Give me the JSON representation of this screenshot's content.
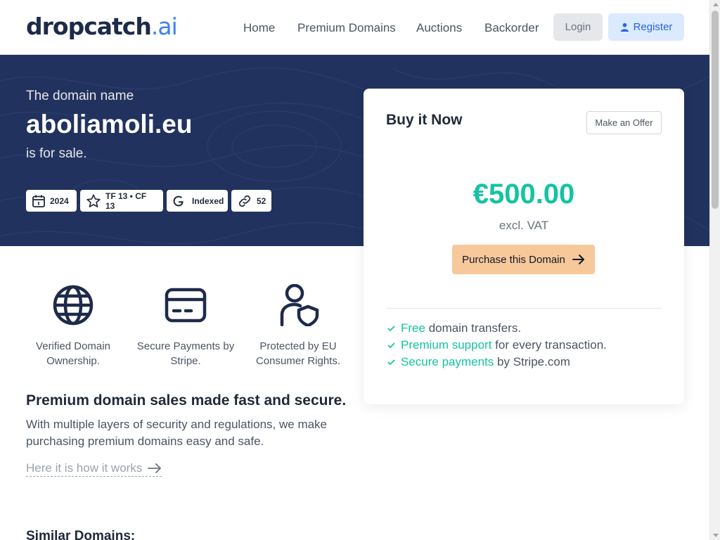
{
  "header": {
    "logo_main": "dropcatch",
    "logo_dot": ".",
    "logo_ai": "ai",
    "nav": [
      "Home",
      "Premium Domains",
      "Auctions",
      "Backorder"
    ],
    "login_label": "Login",
    "register_label": "Register"
  },
  "hero": {
    "intro": "The domain name",
    "domain": "aboliamoli.eu",
    "for_sale": "is for sale.",
    "badges": {
      "year": "2024",
      "trust": "TF 13 • CF 13",
      "google": "Indexed",
      "links": "52"
    }
  },
  "card": {
    "title": "Buy it Now",
    "offer_label": "Make an Offer",
    "price": "€500.00",
    "vat": "excl. VAT",
    "buy_label": "Purchase this Domain",
    "features": [
      {
        "highlight": "Free",
        "rest": "domain transfers."
      },
      {
        "highlight": "Premium support",
        "rest": "for every transaction."
      },
      {
        "highlight": "Secure payments",
        "rest": "by Stripe.com"
      }
    ]
  },
  "trust": [
    {
      "icon": "globe-icon",
      "line1": "Verified Domain",
      "line2": "Ownership."
    },
    {
      "icon": "credit-card-icon",
      "line1": "Secure Payments by",
      "line2": "Stripe."
    },
    {
      "icon": "user-shield-icon",
      "line1": "Protected by EU",
      "line2": "Consumer Rights."
    }
  ],
  "info": {
    "title": "Premium domain sales made fast and secure.",
    "text": "With multiple layers of security and regulations, we make purchasing premium domains easy and safe.",
    "link": "Here it is how it works",
    "similar": "Similar Domains:"
  },
  "colors": {
    "hero_bg": "#21325e",
    "accent": "#14c3a4",
    "buy_button": "#f7c89a",
    "logo_ai": "#3b82f6"
  }
}
